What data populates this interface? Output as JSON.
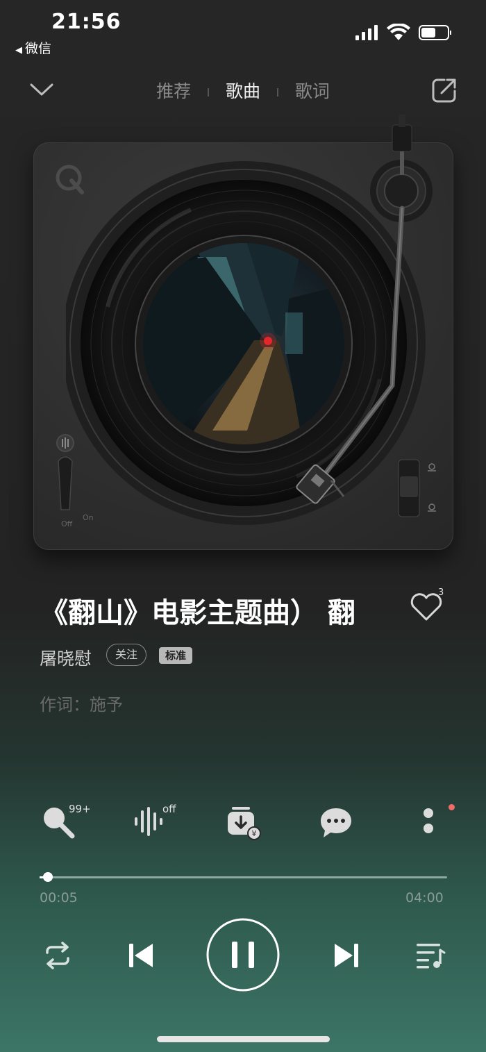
{
  "status_bar": {
    "time": "21:56",
    "back_app": "微信"
  },
  "nav": {
    "tabs": [
      {
        "label": "推荐",
        "active": false
      },
      {
        "label": "歌曲",
        "active": true
      },
      {
        "label": "歌词",
        "active": false
      }
    ]
  },
  "song": {
    "title": "《翻山》电影主题曲） 翻",
    "like_count": "3",
    "artist": "屠晓慰",
    "follow_label": "关注",
    "quality_label": "标准",
    "lyricist": "作词：施予"
  },
  "turntable": {
    "switch_off": "Off",
    "switch_on": "On"
  },
  "actions": {
    "sing_badge": "99+",
    "effect_badge": "off"
  },
  "progress": {
    "current": "00:05",
    "total": "04:00",
    "fraction": 0.021
  },
  "colors": {
    "accent_dot": "#f26b6b",
    "bottom_gradient": "#3c7566"
  }
}
